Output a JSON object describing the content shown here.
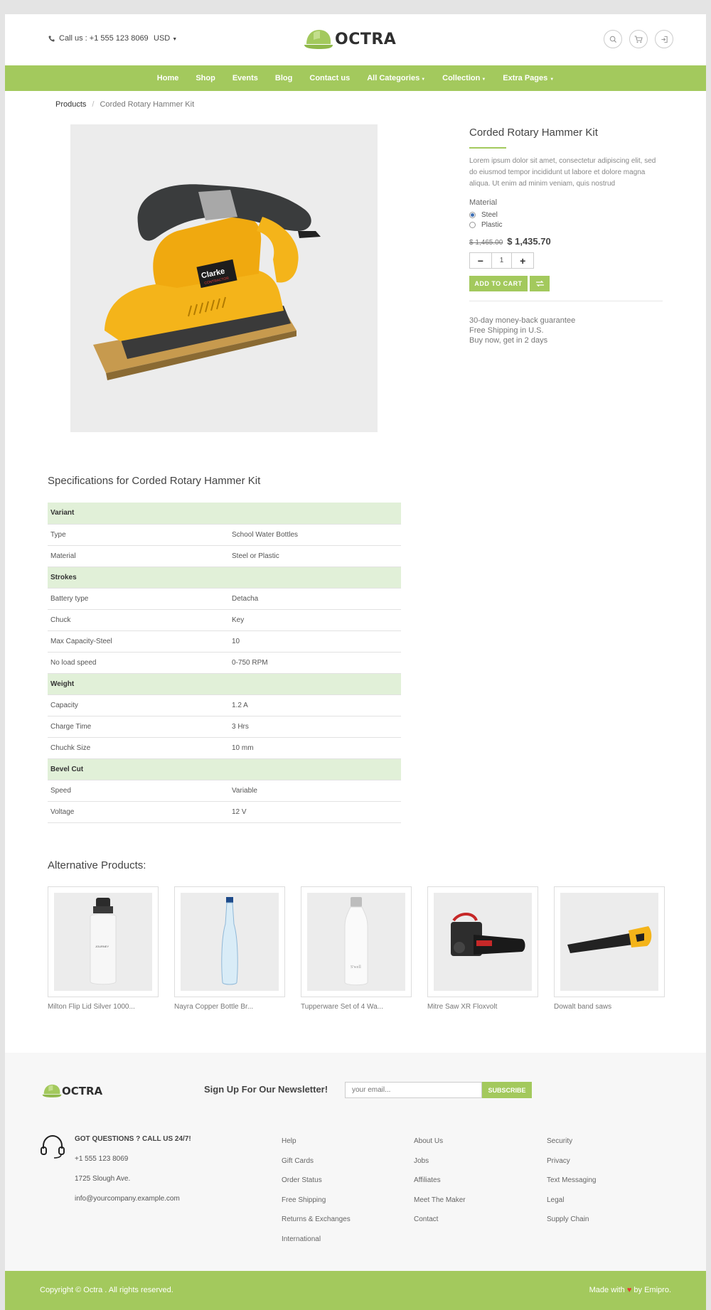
{
  "header": {
    "call": "Call us : +1 555 123 8069",
    "currency": "USD",
    "logo": "OCTRA"
  },
  "nav": [
    "Home",
    "Shop",
    "Events",
    "Blog",
    "Contact us",
    "All Categories",
    "Collection",
    "Extra Pages"
  ],
  "breadcrumb": {
    "parent": "Products",
    "current": "Corded Rotary Hammer Kit"
  },
  "product": {
    "title": "Corded Rotary Hammer Kit",
    "description": "Lorem ipsum dolor sit amet, consectetur adipiscing elit, sed do eiusmod tempor incididunt ut labore et dolore magna aliqua. Ut enim ad minim veniam, quis nostrud",
    "material_label": "Material",
    "materials": [
      "Steel",
      "Plastic"
    ],
    "selected_material": "Steel",
    "old_price": "$ 1,465.00",
    "price": "$ 1,435.70",
    "quantity": "1",
    "add_to_cart": "ADD TO CART",
    "guarantee": [
      "30-day money-back guarantee",
      "Free Shipping in U.S.",
      "Buy now, get in 2 days"
    ]
  },
  "specs": {
    "title": "Specifications for Corded Rotary Hammer Kit",
    "groups": [
      {
        "name": "Variant",
        "rows": [
          [
            "Type",
            "School Water Bottles"
          ],
          [
            "Material",
            "Steel or Plastic"
          ]
        ]
      },
      {
        "name": "Strokes",
        "rows": [
          [
            "Battery type",
            "Detacha"
          ],
          [
            "Chuck",
            "Key"
          ],
          [
            "Max Capacity-Steel",
            "10"
          ],
          [
            "No load speed",
            "0-750 RPM"
          ]
        ]
      },
      {
        "name": "Weight",
        "rows": [
          [
            "Capacity",
            "1.2 A"
          ],
          [
            "Charge Time",
            "3 Hrs"
          ],
          [
            "Chuchk Size",
            "10 mm"
          ]
        ]
      },
      {
        "name": "Bevel Cut",
        "rows": [
          [
            "Speed",
            "Variable"
          ],
          [
            "Voltage",
            "12 V"
          ]
        ]
      }
    ]
  },
  "alternatives": {
    "title": "Alternative Products:",
    "items": [
      {
        "name": "Milton Flip Lid Silver 1000...",
        "icon": "white-bottle-icon"
      },
      {
        "name": "Nayra Copper Bottle Br...",
        "icon": "glass-bottle-icon"
      },
      {
        "name": "Tupperware Set of 4 Wa...",
        "icon": "steel-bottle-icon"
      },
      {
        "name": "Mitre Saw XR Floxvolt",
        "icon": "chainsaw-icon"
      },
      {
        "name": "Dowalt band saws",
        "icon": "handsaw-icon"
      }
    ]
  },
  "footer": {
    "logo": "OCTRA",
    "newsletter_title": "Sign Up For Our Newsletter!",
    "email_placeholder": "your email...",
    "subscribe": "SUBSCRIBE",
    "contact": {
      "heading": "GOT QUESTIONS ? CALL US 24/7!",
      "phone": "+1 555 123 8069",
      "address": "1725 Slough Ave.",
      "email": "info@yourcompany.example.com"
    },
    "col1": [
      "Help",
      "Gift Cards",
      "Order Status",
      "Free Shipping",
      "Returns & Exchanges",
      "International"
    ],
    "col2": [
      "About Us",
      "Jobs",
      "Affiliates",
      "Meet The Maker",
      "Contact"
    ],
    "col3": [
      "Security",
      "Privacy",
      "Text Messaging",
      "Legal",
      "Supply Chain"
    ],
    "copyright": "Copyright © Octra . All rights reserved.",
    "made_with": "Made with",
    "made_by": "by Emipro."
  },
  "colors": {
    "accent": "#a3c95d",
    "spec_group_bg": "#e1f0d8",
    "heart": "#e53935"
  }
}
